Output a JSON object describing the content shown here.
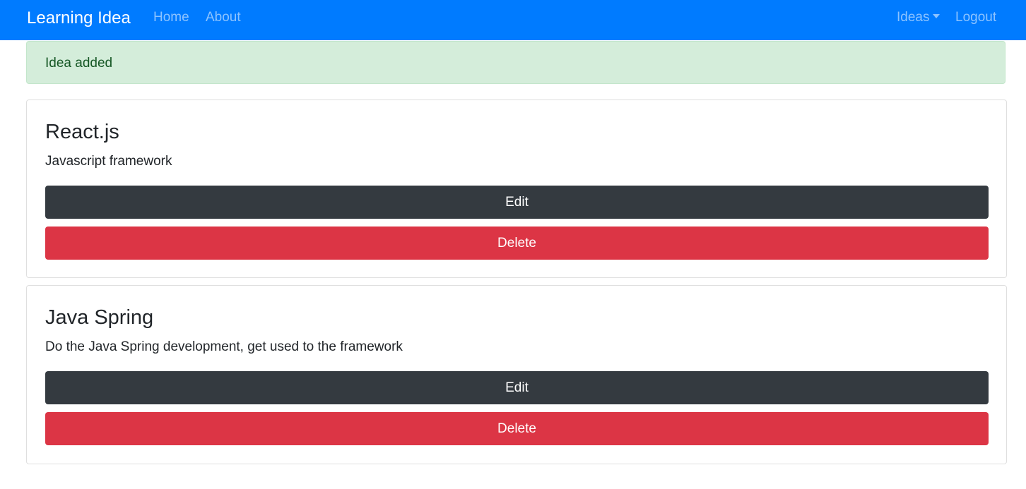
{
  "navbar": {
    "brand": "Learning Idea",
    "links": [
      "Home",
      "About"
    ],
    "ideas_label": "Ideas",
    "logout_label": "Logout",
    "color": "#007bff"
  },
  "alert": {
    "text": "Idea added",
    "type": "success"
  },
  "ideas": [
    {
      "title": "React.js",
      "details": "Javascript framework",
      "edit_label": "Edit",
      "delete_label": "Delete"
    },
    {
      "title": "Java Spring",
      "details": "Do the Java Spring development, get used to the framework",
      "edit_label": "Edit",
      "delete_label": "Delete"
    }
  ],
  "colors": {
    "edit_button": "#343a40",
    "delete_button": "#dc3545",
    "alert_background": "#d4edda"
  }
}
